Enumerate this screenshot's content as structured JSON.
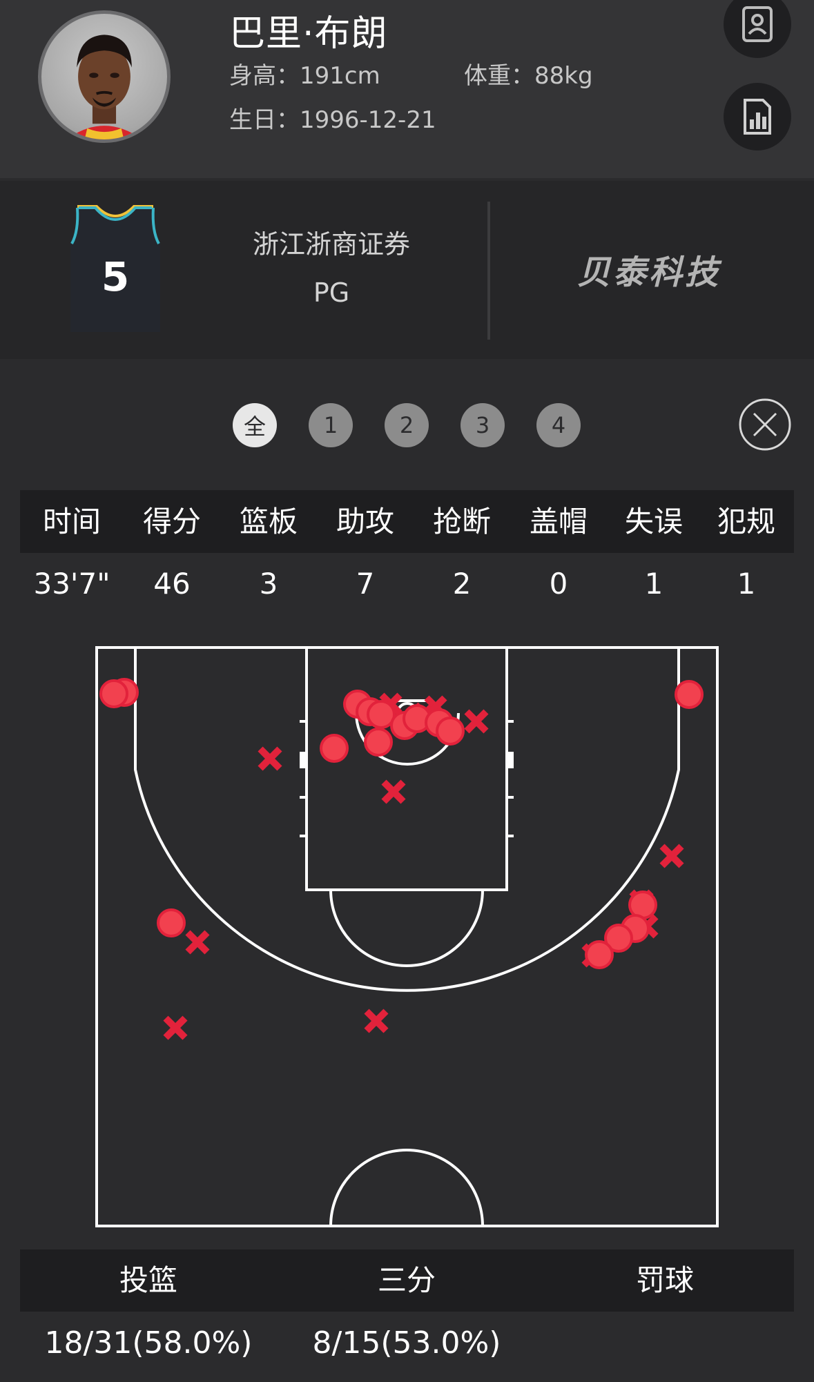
{
  "player": {
    "name": "巴里·布朗",
    "height": "身高：191cm",
    "weight": "体重：88kg",
    "birthday": "生日：1996-12-21"
  },
  "team": {
    "name": "浙江浙商证券",
    "position": "PG",
    "jersey_number": "5",
    "sponsor": "贝泰科技"
  },
  "icons": {
    "profile": "profile-card-icon",
    "stats": "bar-chart-document-icon",
    "close": "close-icon"
  },
  "quarters": [
    "全",
    "1",
    "2",
    "3",
    "4"
  ],
  "selected_quarter": "全",
  "stats_table": {
    "headers": [
      "时间",
      "得分",
      "篮板",
      "助攻",
      "抢断",
      "盖帽",
      "失误",
      "犯规"
    ],
    "values": [
      "33'7\"",
      "46",
      "3",
      "7",
      "2",
      "0",
      "1",
      "1"
    ]
  },
  "shooting": {
    "headers": [
      "投篮",
      "三分",
      "罚球"
    ],
    "values": [
      "18/31(58.0%)",
      "8/15(53.0%)",
      ""
    ]
  },
  "colors": {
    "background": "#2b2b2d",
    "header": "#343436",
    "shot": "#e2223b",
    "court_line": "#ffffff"
  }
}
